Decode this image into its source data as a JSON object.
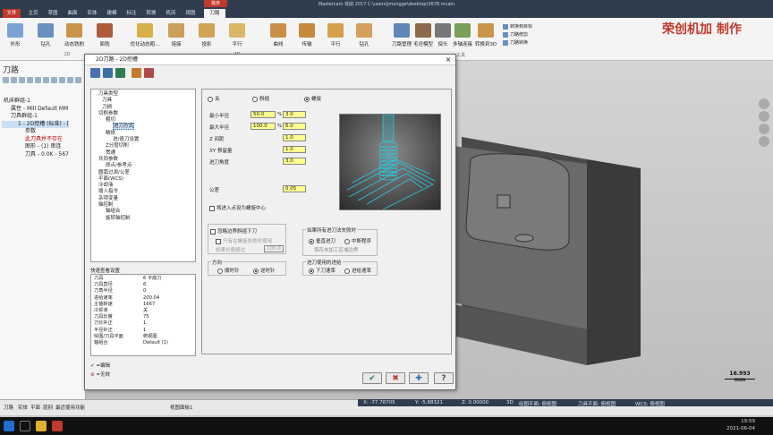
{
  "window": {
    "title": "Mastercam 铣削 2017  C:\\users\\jmongge\\desktop\\3678.mcam",
    "context_tab": "铣床"
  },
  "tabs": [
    "文件",
    "主页",
    "草图",
    "曲面",
    "实体",
    "建模",
    "标注",
    "转换",
    "机床",
    "视图",
    "刀路"
  ],
  "ribbon": {
    "buttons": [
      "外形",
      "钻孔",
      "动态铣削",
      "面铣",
      "优化动态粗...",
      "熔接",
      "投影",
      "平行",
      "放射",
      "曲线",
      "传输",
      "平行",
      "钻孔",
      "刀路管理",
      "毛坯模型",
      "探头",
      "多轴连接",
      "转换到3D"
    ],
    "group_labels": [
      "2D",
      "3D",
      "工具"
    ],
    "small": [
      "转换到目标",
      "刀路修剪",
      "刀路转换"
    ]
  },
  "watermark": "荣创机加  制作",
  "left_panel": {
    "title": "刀路",
    "tree": [
      "机床群组-1",
      "属性 - Mill Default MM",
      "刀具群组-1",
      "1 - 2D挖槽 (标准) - [",
      "参数",
      "此刀具并不存在",
      "图形 - (1) 串连",
      "刀具 - 0.0K - 567"
    ]
  },
  "dialog": {
    "title": "2D刀路 - 2D挖槽",
    "close": "×",
    "nav": [
      "刀具类型",
      "刀具",
      "刀柄",
      "切削参数",
      "粗切",
      "进刀方式",
      "精修",
      "进/退刀设置",
      "Z分层切削",
      "贯通",
      "共同参数",
      "原点/参考点",
      "圆弧过滤/公差",
      "平面(WCS)",
      "冷却液",
      "插入指令",
      "杂项变量",
      "轴控制",
      "轴组合",
      "旋转轴控制"
    ],
    "selected_nav": "进刀方式",
    "quick_view_title": "快速查看设置",
    "quick_view": [
      [
        "刀具",
        "6 平底刀"
      ],
      [
        "刀具直径",
        "6"
      ],
      [
        "刀角半径",
        "0"
      ],
      [
        "进给速率",
        "200.04"
      ],
      [
        "主轴转速",
        "1667"
      ],
      [
        "冷却液",
        "关"
      ],
      [
        "刀具长度",
        "75"
      ],
      [
        "刀长补正",
        "1"
      ],
      [
        "半径补正",
        "1"
      ],
      [
        "绘图/刀具平面",
        "俯视图"
      ],
      [
        "轴组合",
        "Default (1)"
      ]
    ],
    "legend": [
      "=编辑",
      "=无效"
    ],
    "entry": {
      "modes": [
        "关",
        "斜插",
        "螺旋"
      ],
      "selected_mode": "螺旋",
      "fields": [
        {
          "label": "最小半径",
          "pct": "50.0",
          "value": "3.0"
        },
        {
          "label": "最大半径",
          "pct": "100.0",
          "value": "6.0"
        },
        {
          "label": "Z 间距",
          "value": "1.0"
        },
        {
          "label": "XY 预留量",
          "value": "1.0"
        },
        {
          "label": "进刀角度",
          "value": "3.0"
        }
      ],
      "pct_sign": "%",
      "tolerance_label": "公差",
      "tolerance": "0.05",
      "center_chk": "将进入点设为螺旋中心",
      "ramp_box": "忽略边界斜插下刀",
      "ramp_sub": "只有在螺旋失败时使用",
      "ramp_len_label": "如果长度超过",
      "ramp_len": "100.0",
      "fail_title": "如果所有进刀法失败时",
      "fail_opts": [
        "垂直进刀",
        "中断程序"
      ],
      "fail_sel": "垂直进刀",
      "fail_note": "保存未加工区域边界",
      "dir_title": "方向",
      "dir_opts": [
        "顺时针",
        "逆时针"
      ],
      "dir_sel": "逆时针",
      "feed_title": "进刀使用的进给",
      "feed_opts": [
        "下刀速率",
        "进给速率"
      ],
      "feed_sel": "下刀速率"
    },
    "buttons": {
      "ok": "✔",
      "cancel": "✖",
      "add": "✚",
      "help": "?"
    }
  },
  "status": {
    "tabs": [
      "刀路",
      "实体",
      "平面",
      "层别",
      "最近使用功能"
    ],
    "view_tab": "视图面板1",
    "coords": [
      "X: -77.78705",
      "Y: -5.88321",
      "Z: 0.00000",
      "3D",
      "绘图平面: 俯视图",
      "刀具平面: 俯视图",
      "WCS: 俯视图"
    ],
    "scale": "16.993 mm",
    "time": "19:59",
    "date": "2021-06-04"
  }
}
